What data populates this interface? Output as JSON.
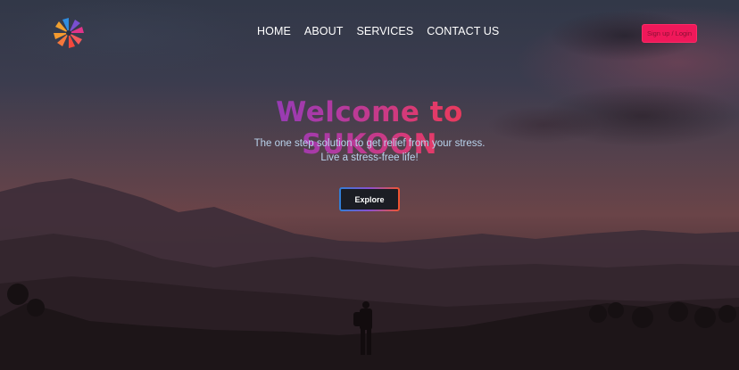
{
  "brand": {
    "logo_icon": "sukoon-logo-icon",
    "colors": [
      "#2f8de0",
      "#f5483c",
      "#f59a2e",
      "#e0348a"
    ]
  },
  "nav": {
    "items": [
      "HOME",
      "ABOUT",
      "SERVICES",
      "CONTACT US"
    ]
  },
  "header": {
    "signup_label": "Sign up / Login",
    "signup_color": "#f0185a"
  },
  "hero": {
    "title": "Welcome to SUKOON",
    "tagline_line1": "The one step solution to get relief from your stress.",
    "tagline_line2": "Live a stress-free life!",
    "cta_label": "Explore"
  }
}
